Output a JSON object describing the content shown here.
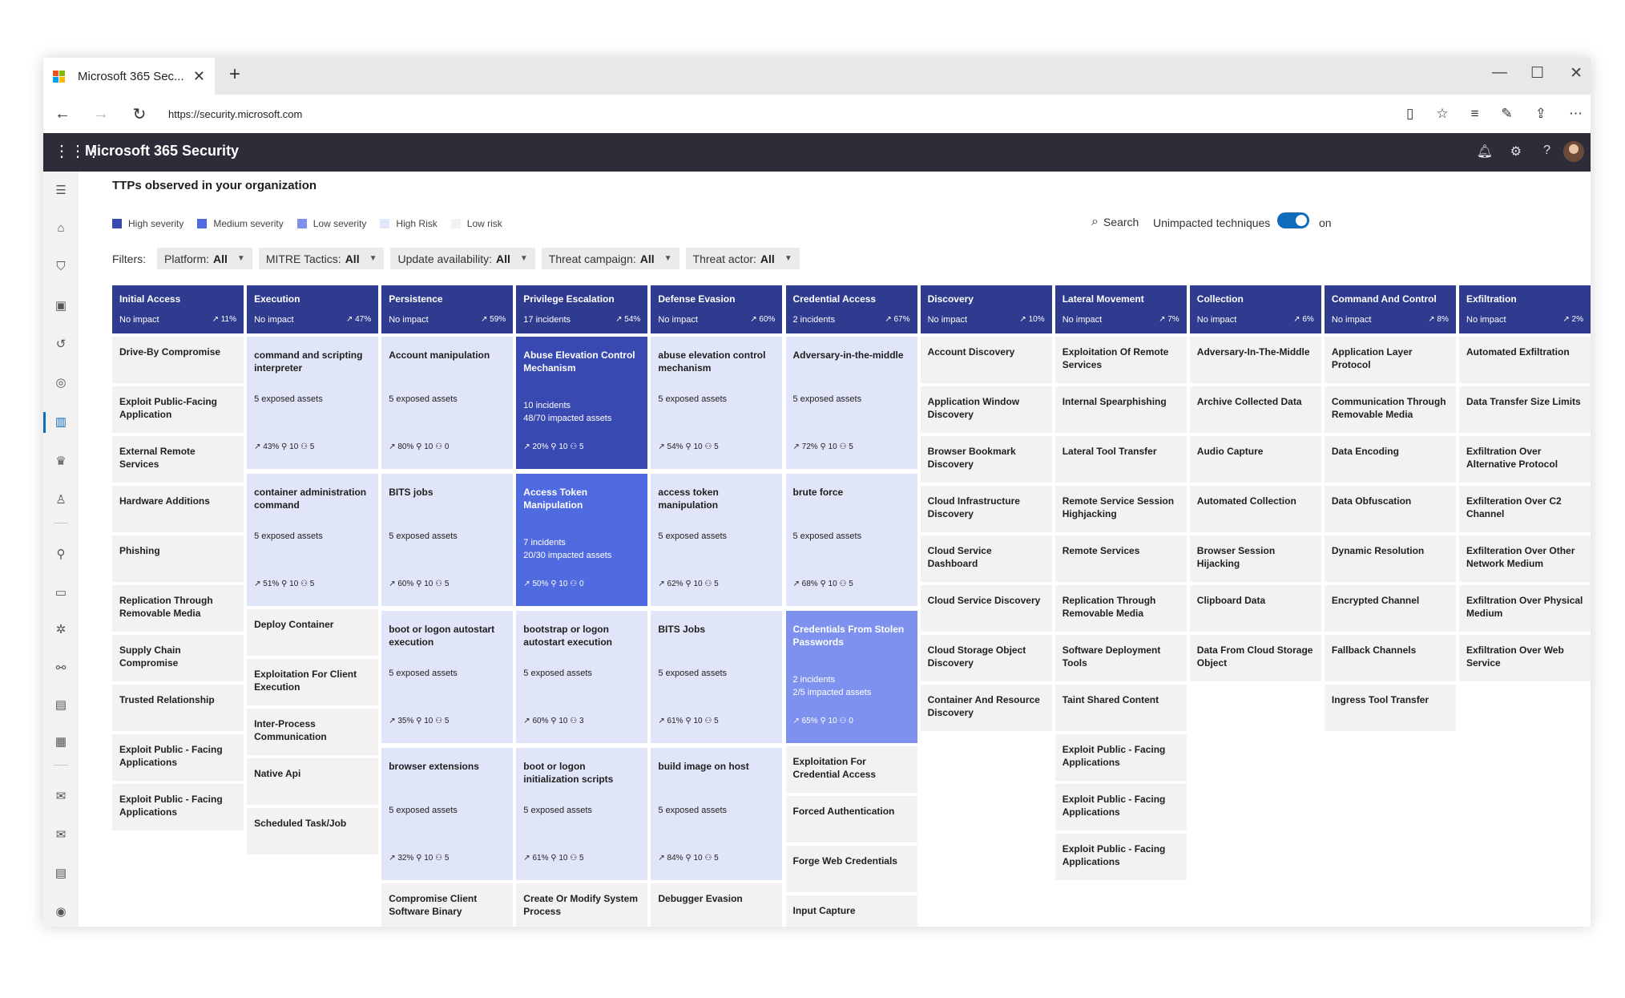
{
  "browser": {
    "tab_title": "Microsoft 365 Sec...",
    "url": "https://security.microsoft.com",
    "logo_colors": [
      "#f25022",
      "#7fba00",
      "#00a4ef",
      "#ffb900"
    ]
  },
  "app": {
    "title": "Microsoft 365 Security"
  },
  "page": {
    "title": "TTPs observed in your organization",
    "legend": [
      {
        "label": "High severity",
        "color": "#3949b2"
      },
      {
        "label": "Medium severity",
        "color": "#4f6bdf"
      },
      {
        "label": "Low severity",
        "color": "#7f91ee"
      },
      {
        "label": "High Risk",
        "color": "#e0e5f9"
      },
      {
        "label": "Low risk",
        "color": "#f3f2f1"
      }
    ],
    "search_label": "Search",
    "unimpacted_label": "Unimpacted techniques",
    "toggle_state": "on",
    "filters_label": "Filters:",
    "filters": [
      {
        "label": "Platform:",
        "value": "All"
      },
      {
        "label": "MITRE Tactics:",
        "value": "All"
      },
      {
        "label": "Update availability:",
        "value": "All"
      },
      {
        "label": "Threat campaign:",
        "value": "All"
      },
      {
        "label": "Threat actor:",
        "value": "All"
      }
    ]
  },
  "tactics": [
    {
      "name": "Initial Access",
      "impact": "No impact",
      "pct": "↗ 11%",
      "cells": [
        {
          "name": "Drive-By Compromise"
        },
        {
          "name": "Exploit Public-Facing Application"
        },
        {
          "name": "External Remote Services"
        },
        {
          "name": "Hardware Additions"
        },
        {
          "name": "Phishing"
        },
        {
          "name": "Replication Through Removable Media"
        },
        {
          "name": "Supply Chain Compromise"
        },
        {
          "name": "Trusted Relationship"
        },
        {
          "name": "Exploit Public - Facing Applications"
        },
        {
          "name": "Exploit Public - Facing Applications"
        }
      ]
    },
    {
      "name": "Execution",
      "impact": "No impact",
      "pct": "↗ 47%",
      "cells": [
        {
          "name": "command and scripting interpreter",
          "big": true,
          "level": "low",
          "a1": "5 exposed assets",
          "stats": "↗ 43%   ⚲ 10   ⚇ 5"
        },
        {
          "name": "container administration command",
          "big": true,
          "level": "low",
          "a1": "5 exposed assets",
          "stats": "↗ 51%   ⚲ 10   ⚇ 5"
        },
        {
          "name": "Deploy Container"
        },
        {
          "name": "Exploitation For Client Execution"
        },
        {
          "name": "Inter-Process Communication"
        },
        {
          "name": "Native Api"
        },
        {
          "name": "Scheduled Task/Job"
        }
      ]
    },
    {
      "name": "Persistence",
      "impact": "No impact",
      "pct": "↗ 59%",
      "cells": [
        {
          "name": "Account manipulation",
          "big": true,
          "level": "low",
          "a1": "5 exposed assets",
          "stats": "↗ 80%   ⚲ 10   ⚇ 0"
        },
        {
          "name": "BITS jobs",
          "big": true,
          "level": "low",
          "a1": "5 exposed assets",
          "stats": "↗ 60%   ⚲ 10   ⚇ 5"
        },
        {
          "name": "boot or logon autostart execution",
          "big": true,
          "level": "low",
          "a1": "5 exposed assets",
          "stats": "↗ 35%   ⚲ 10   ⚇ 5"
        },
        {
          "name": "browser extensions",
          "big": true,
          "level": "low",
          "a1": "5 exposed assets",
          "stats": "↗ 32%   ⚲ 10   ⚇ 5"
        },
        {
          "name": "Compromise Client Software Binary"
        }
      ]
    },
    {
      "name": "Privilege Escalation",
      "impact": "17 incidents",
      "pct": "↗ 54%",
      "cells": [
        {
          "name": "Abuse Elevation Control Mechanism",
          "big": true,
          "level": "high",
          "a1": "10 incidents",
          "a2": "48/70 impacted assets",
          "stats": "↗ 20%   ⚲ 10   ⚇ 5"
        },
        {
          "name": "Access Token Manipulation",
          "big": true,
          "level": "med",
          "a1": "7 incidents",
          "a2": "20/30 impacted assets",
          "stats": "↗ 50%   ⚲ 10   ⚇ 0"
        },
        {
          "name": "bootstrap or logon autostart execution",
          "big": true,
          "level": "low",
          "a1": "5 exposed assets",
          "stats": "↗ 60%   ⚲ 10   ⚇ 3"
        },
        {
          "name": "boot or logon initialization scripts",
          "big": true,
          "level": "low",
          "a1": "5 exposed assets",
          "stats": "↗ 61%   ⚲ 10   ⚇ 5"
        },
        {
          "name": "Create Or Modify System Process"
        }
      ]
    },
    {
      "name": "Defense Evasion",
      "impact": "No impact",
      "pct": "↗ 60%",
      "cells": [
        {
          "name": "abuse elevation control mechanism",
          "big": true,
          "level": "low",
          "a1": "5 exposed assets",
          "stats": "↗ 54%   ⚲ 10   ⚇ 5"
        },
        {
          "name": "access token manipulation",
          "big": true,
          "level": "low",
          "a1": "5 exposed assets",
          "stats": "↗ 62%   ⚲ 10   ⚇ 5"
        },
        {
          "name": "BITS Jobs",
          "big": true,
          "level": "low",
          "a1": "5 exposed assets",
          "stats": "↗ 61%   ⚲ 10   ⚇ 5"
        },
        {
          "name": "build image on host",
          "big": true,
          "level": "low",
          "a1": "5 exposed assets",
          "stats": "↗ 84%   ⚲ 10   ⚇ 5"
        },
        {
          "name": "Debugger Evasion"
        }
      ]
    },
    {
      "name": "Credential Access",
      "impact": "2 incidents",
      "pct": "↗ 67%",
      "cells": [
        {
          "name": "Adversary-in-the-middle",
          "big": true,
          "level": "low",
          "a1": "5 exposed assets",
          "stats": "↗ 72%   ⚲ 10   ⚇ 5"
        },
        {
          "name": "brute force",
          "big": true,
          "level": "low",
          "a1": "5 exposed assets",
          "stats": "↗ 68%   ⚲ 10   ⚇ 5"
        },
        {
          "name": "Credentials From Stolen Passwords",
          "big": true,
          "level": "soft",
          "a1": "2 incidents",
          "a2": "2/5 impacted assets",
          "stats": "↗ 65%   ⚲ 10   ⚇ 0"
        },
        {
          "name": "Exploitation For Credential Access"
        },
        {
          "name": "Forced Authentication"
        },
        {
          "name": "Forge Web Credentials"
        },
        {
          "name": "Input Capture"
        }
      ]
    },
    {
      "name": "Discovery",
      "impact": "No impact",
      "pct": "↗ 10%",
      "cells": [
        {
          "name": "Account Discovery"
        },
        {
          "name": "Application Window Discovery"
        },
        {
          "name": "Browser Bookmark Discovery"
        },
        {
          "name": "Cloud Infrastructure Discovery"
        },
        {
          "name": "Cloud Service Dashboard"
        },
        {
          "name": "Cloud Service Discovery"
        },
        {
          "name": "Cloud Storage Object Discovery"
        },
        {
          "name": "Container And Resource Discovery"
        }
      ]
    },
    {
      "name": "Lateral Movement",
      "impact": "No impact",
      "pct": "↗ 7%",
      "cells": [
        {
          "name": "Exploitation Of Remote Services"
        },
        {
          "name": "Internal Spearphishing"
        },
        {
          "name": "Lateral Tool Transfer"
        },
        {
          "name": "Remote Service Session Highjacking"
        },
        {
          "name": "Remote Services"
        },
        {
          "name": "Replication Through Removable Media"
        },
        {
          "name": "Software Deployment Tools"
        },
        {
          "name": "Taint Shared Content"
        },
        {
          "name": "Exploit Public - Facing Applications"
        },
        {
          "name": "Exploit Public - Facing Applications"
        },
        {
          "name": "Exploit Public - Facing Applications"
        }
      ]
    },
    {
      "name": "Collection",
      "impact": "No impact",
      "pct": "↗ 6%",
      "cells": [
        {
          "name": "Adversary-In-The-Middle"
        },
        {
          "name": "Archive Collected Data"
        },
        {
          "name": "Audio Capture"
        },
        {
          "name": "Automated Collection"
        },
        {
          "name": "Browser Session Hijacking"
        },
        {
          "name": "Clipboard Data"
        },
        {
          "name": "Data From Cloud Storage Object"
        }
      ]
    },
    {
      "name": "Command And Control",
      "impact": "No impact",
      "pct": "↗ 8%",
      "cells": [
        {
          "name": "Application Layer Protocol"
        },
        {
          "name": "Communication Through Removable Media"
        },
        {
          "name": "Data Encoding"
        },
        {
          "name": "Data Obfuscation"
        },
        {
          "name": "Dynamic Resolution"
        },
        {
          "name": "Encrypted Channel"
        },
        {
          "name": "Fallback Channels"
        },
        {
          "name": "Ingress Tool Transfer"
        }
      ]
    },
    {
      "name": "Exfiltration",
      "impact": "No impact",
      "pct": "↗ 2%",
      "cells": [
        {
          "name": "Automated Exfiltration"
        },
        {
          "name": "Data Transfer Size Limits"
        },
        {
          "name": "Exfiltration Over Alternative Protocol"
        },
        {
          "name": "Exfilteration Over C2 Channel"
        },
        {
          "name": "Exfilteration Over Other Network Medium"
        },
        {
          "name": "Exfiltration Over Physical Medium"
        },
        {
          "name": "Exfiltration Over Web Service"
        }
      ]
    }
  ]
}
